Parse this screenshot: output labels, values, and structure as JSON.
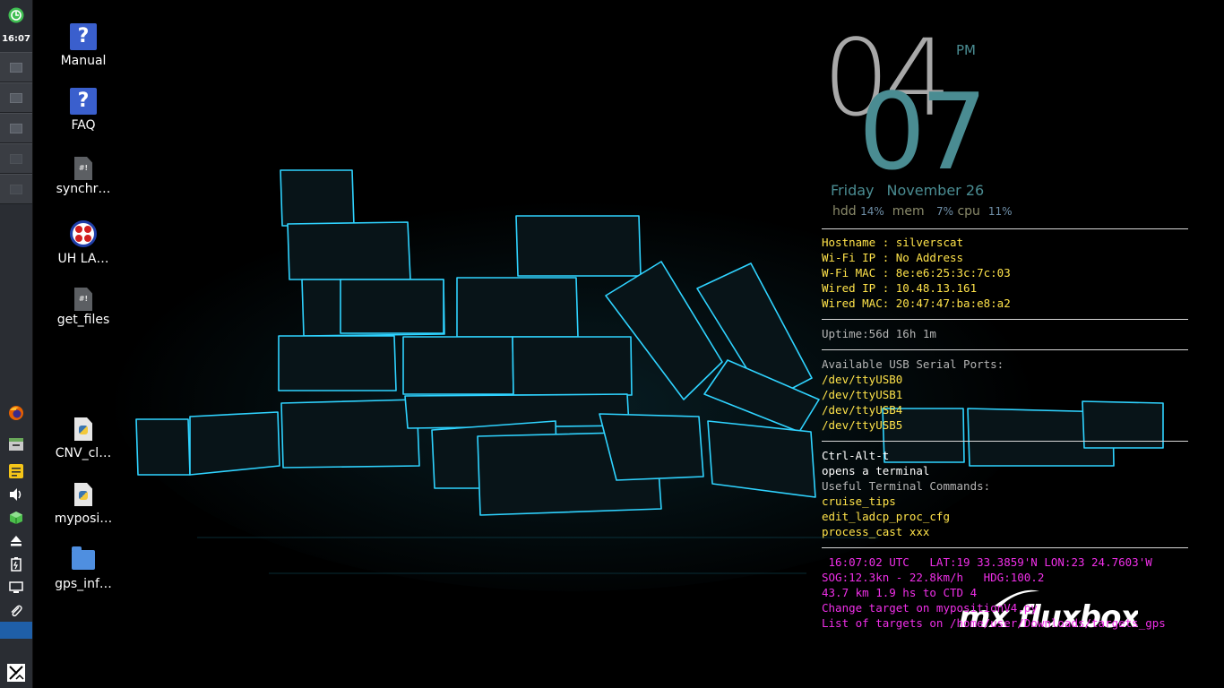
{
  "panel": {
    "time": "16:07",
    "launchers": [
      "firefox-icon",
      "file-manager-icon",
      "notes-icon",
      "volume-icon",
      "package-icon",
      "eject-icon",
      "battery-icon",
      "display-icon",
      "paperclip-icon"
    ]
  },
  "desktop_icons": [
    {
      "label": "Manual",
      "icon": "help-icon"
    },
    {
      "label": "FAQ",
      "icon": "help-icon"
    },
    {
      "label": "synchr…",
      "icon": "script-file-icon"
    },
    {
      "label": "UH LA…",
      "icon": "uh-logo-icon"
    },
    {
      "label": "get_files",
      "icon": "script-file-icon"
    },
    {
      "label": "CNV_cl…",
      "icon": "python-file-icon"
    },
    {
      "label": "myposi…",
      "icon": "python-file-icon"
    },
    {
      "label": "gps_inf…",
      "icon": "folder-icon"
    }
  ],
  "clock": {
    "hour": "04",
    "minute": "07",
    "ampm": "PM",
    "weekday": "Friday",
    "date": "November 26"
  },
  "stats": {
    "hdd_label": "hdd",
    "hdd": "14%",
    "mem_label": "mem",
    "mem": "7%",
    "cpu_label": "cpu",
    "cpu": "11%"
  },
  "network": [
    "Hostname : silverscat",
    "Wi-Fi IP : No Address",
    "W-Fi MAC : 8e:e6:25:3c:7c:03",
    "Wired IP : 10.48.13.161",
    "Wired MAC: 20:47:47:ba:e8:a2"
  ],
  "uptime": "Uptime:56d 16h 1m",
  "usb": {
    "heading": "Available USB Serial Ports:",
    "ports": [
      "/dev/ttyUSB0",
      "/dev/ttyUSB1",
      "/dev/ttyUSB4",
      "/dev/ttyUSB5"
    ]
  },
  "help": {
    "shortcut": "Ctrl-Alt-t",
    "shortcut_desc": "opens a terminal",
    "commands_heading": "Useful Terminal Commands:",
    "commands": [
      "cruise_tips",
      "edit_ladcp_proc_cfg",
      "process_cast xxx"
    ]
  },
  "gps": [
    " 16:07:02 UTC   LAT:19 33.3859'N LON:23 24.7603'W",
    "SOG:12.3kn - 22.8km/h   HDG:100.2",
    "43.7 km 1.9 hs to CTD 4",
    "Change target on mypositionV4.py",
    "List of targets on /home/user/Downloads/targets_gps"
  ],
  "brand": "mx fluxbox",
  "colors": {
    "panel": "#2a2d33",
    "accent_teal": "#4a8c92",
    "conky_yellow": "#ffe34a",
    "conky_magenta": "#f02fe8",
    "cube_edge": "#2fd3ff"
  }
}
